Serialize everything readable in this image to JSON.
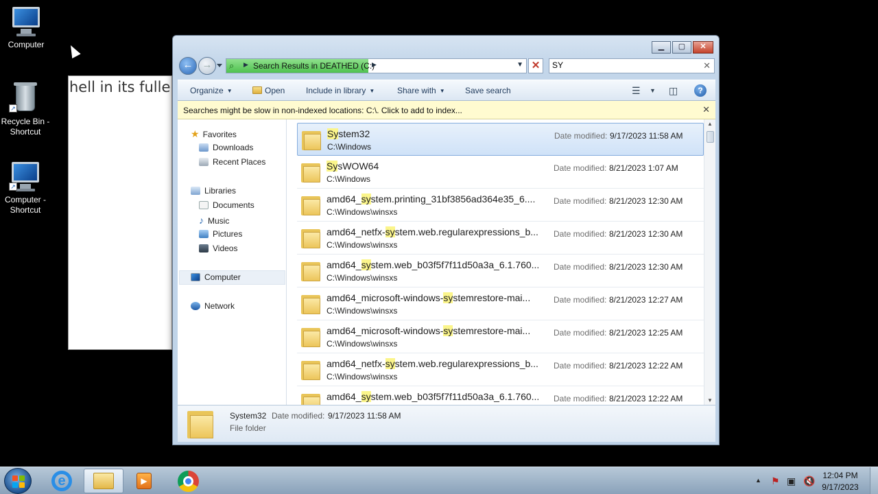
{
  "desktop": {
    "icons": [
      {
        "label_line1": "Computer",
        "label_line2": ""
      },
      {
        "label_line1": "Recycle Bin -",
        "label_line2": "Shortcut"
      },
      {
        "label_line1": "Computer -",
        "label_line2": "Shortcut"
      }
    ],
    "background_window_text": "hell in its fulle"
  },
  "explorer": {
    "address_text": "Search Results in DEATHED (C:)",
    "search_value": "SY",
    "toolbar": {
      "organize": "Organize",
      "open": "Open",
      "include_in_library": "Include in library",
      "share_with": "Share with",
      "save_search": "Save search"
    },
    "infobar_text": "Searches might be slow in non-indexed locations: C:\\. Click to add to index...",
    "nav": {
      "favorites": "Favorites",
      "downloads": "Downloads",
      "recent_places": "Recent Places",
      "libraries": "Libraries",
      "documents": "Documents",
      "music": "Music",
      "pictures": "Pictures",
      "videos": "Videos",
      "computer": "Computer",
      "network": "Network"
    },
    "date_label": "Date modified:",
    "results": [
      {
        "pre": "",
        "hl": "Sy",
        "post": "stem32",
        "path": "C:\\Windows",
        "date": "9/17/2023 11:58 AM"
      },
      {
        "pre": "",
        "hl": "Sy",
        "post": "sWOW64",
        "path": "C:\\Windows",
        "date": "8/21/2023 1:07 AM"
      },
      {
        "pre": "amd64_",
        "hl": "sy",
        "post": "stem.printing_31bf3856ad364e35_6....",
        "path": "C:\\Windows\\winsxs",
        "date": "8/21/2023 12:30 AM"
      },
      {
        "pre": "amd64_netfx-",
        "hl": "sy",
        "post": "stem.web.regularexpressions_b...",
        "path": "C:\\Windows\\winsxs",
        "date": "8/21/2023 12:30 AM"
      },
      {
        "pre": "amd64_",
        "hl": "sy",
        "post": "stem.web_b03f5f7f11d50a3a_6.1.760...",
        "path": "C:\\Windows\\winsxs",
        "date": "8/21/2023 12:30 AM"
      },
      {
        "pre": "amd64_microsoft-windows-",
        "hl": "sy",
        "post": "stemrestore-mai...",
        "path": "C:\\Windows\\winsxs",
        "date": "8/21/2023 12:27 AM"
      },
      {
        "pre": "amd64_microsoft-windows-",
        "hl": "sy",
        "post": "stemrestore-mai...",
        "path": "C:\\Windows\\winsxs",
        "date": "8/21/2023 12:25 AM"
      },
      {
        "pre": "amd64_netfx-",
        "hl": "sy",
        "post": "stem.web.regularexpressions_b...",
        "path": "C:\\Windows\\winsxs",
        "date": "8/21/2023 12:22 AM"
      },
      {
        "pre": "amd64_",
        "hl": "sy",
        "post": "stem.web_b03f5f7f11d50a3a_6.1.760...",
        "path": "",
        "date": "8/21/2023 12:22 AM"
      }
    ],
    "details": {
      "name": "System32",
      "date_label": "Date modified:",
      "date": "9/17/2023 11:58 AM",
      "type": "File folder"
    }
  },
  "taskbar": {
    "clock_time": "12:04 PM",
    "clock_date": "9/17/2023"
  },
  "colors": {
    "highlight": "#fbf58b",
    "address_progress": "#4fc24f",
    "selection": "#cfe2f8"
  }
}
